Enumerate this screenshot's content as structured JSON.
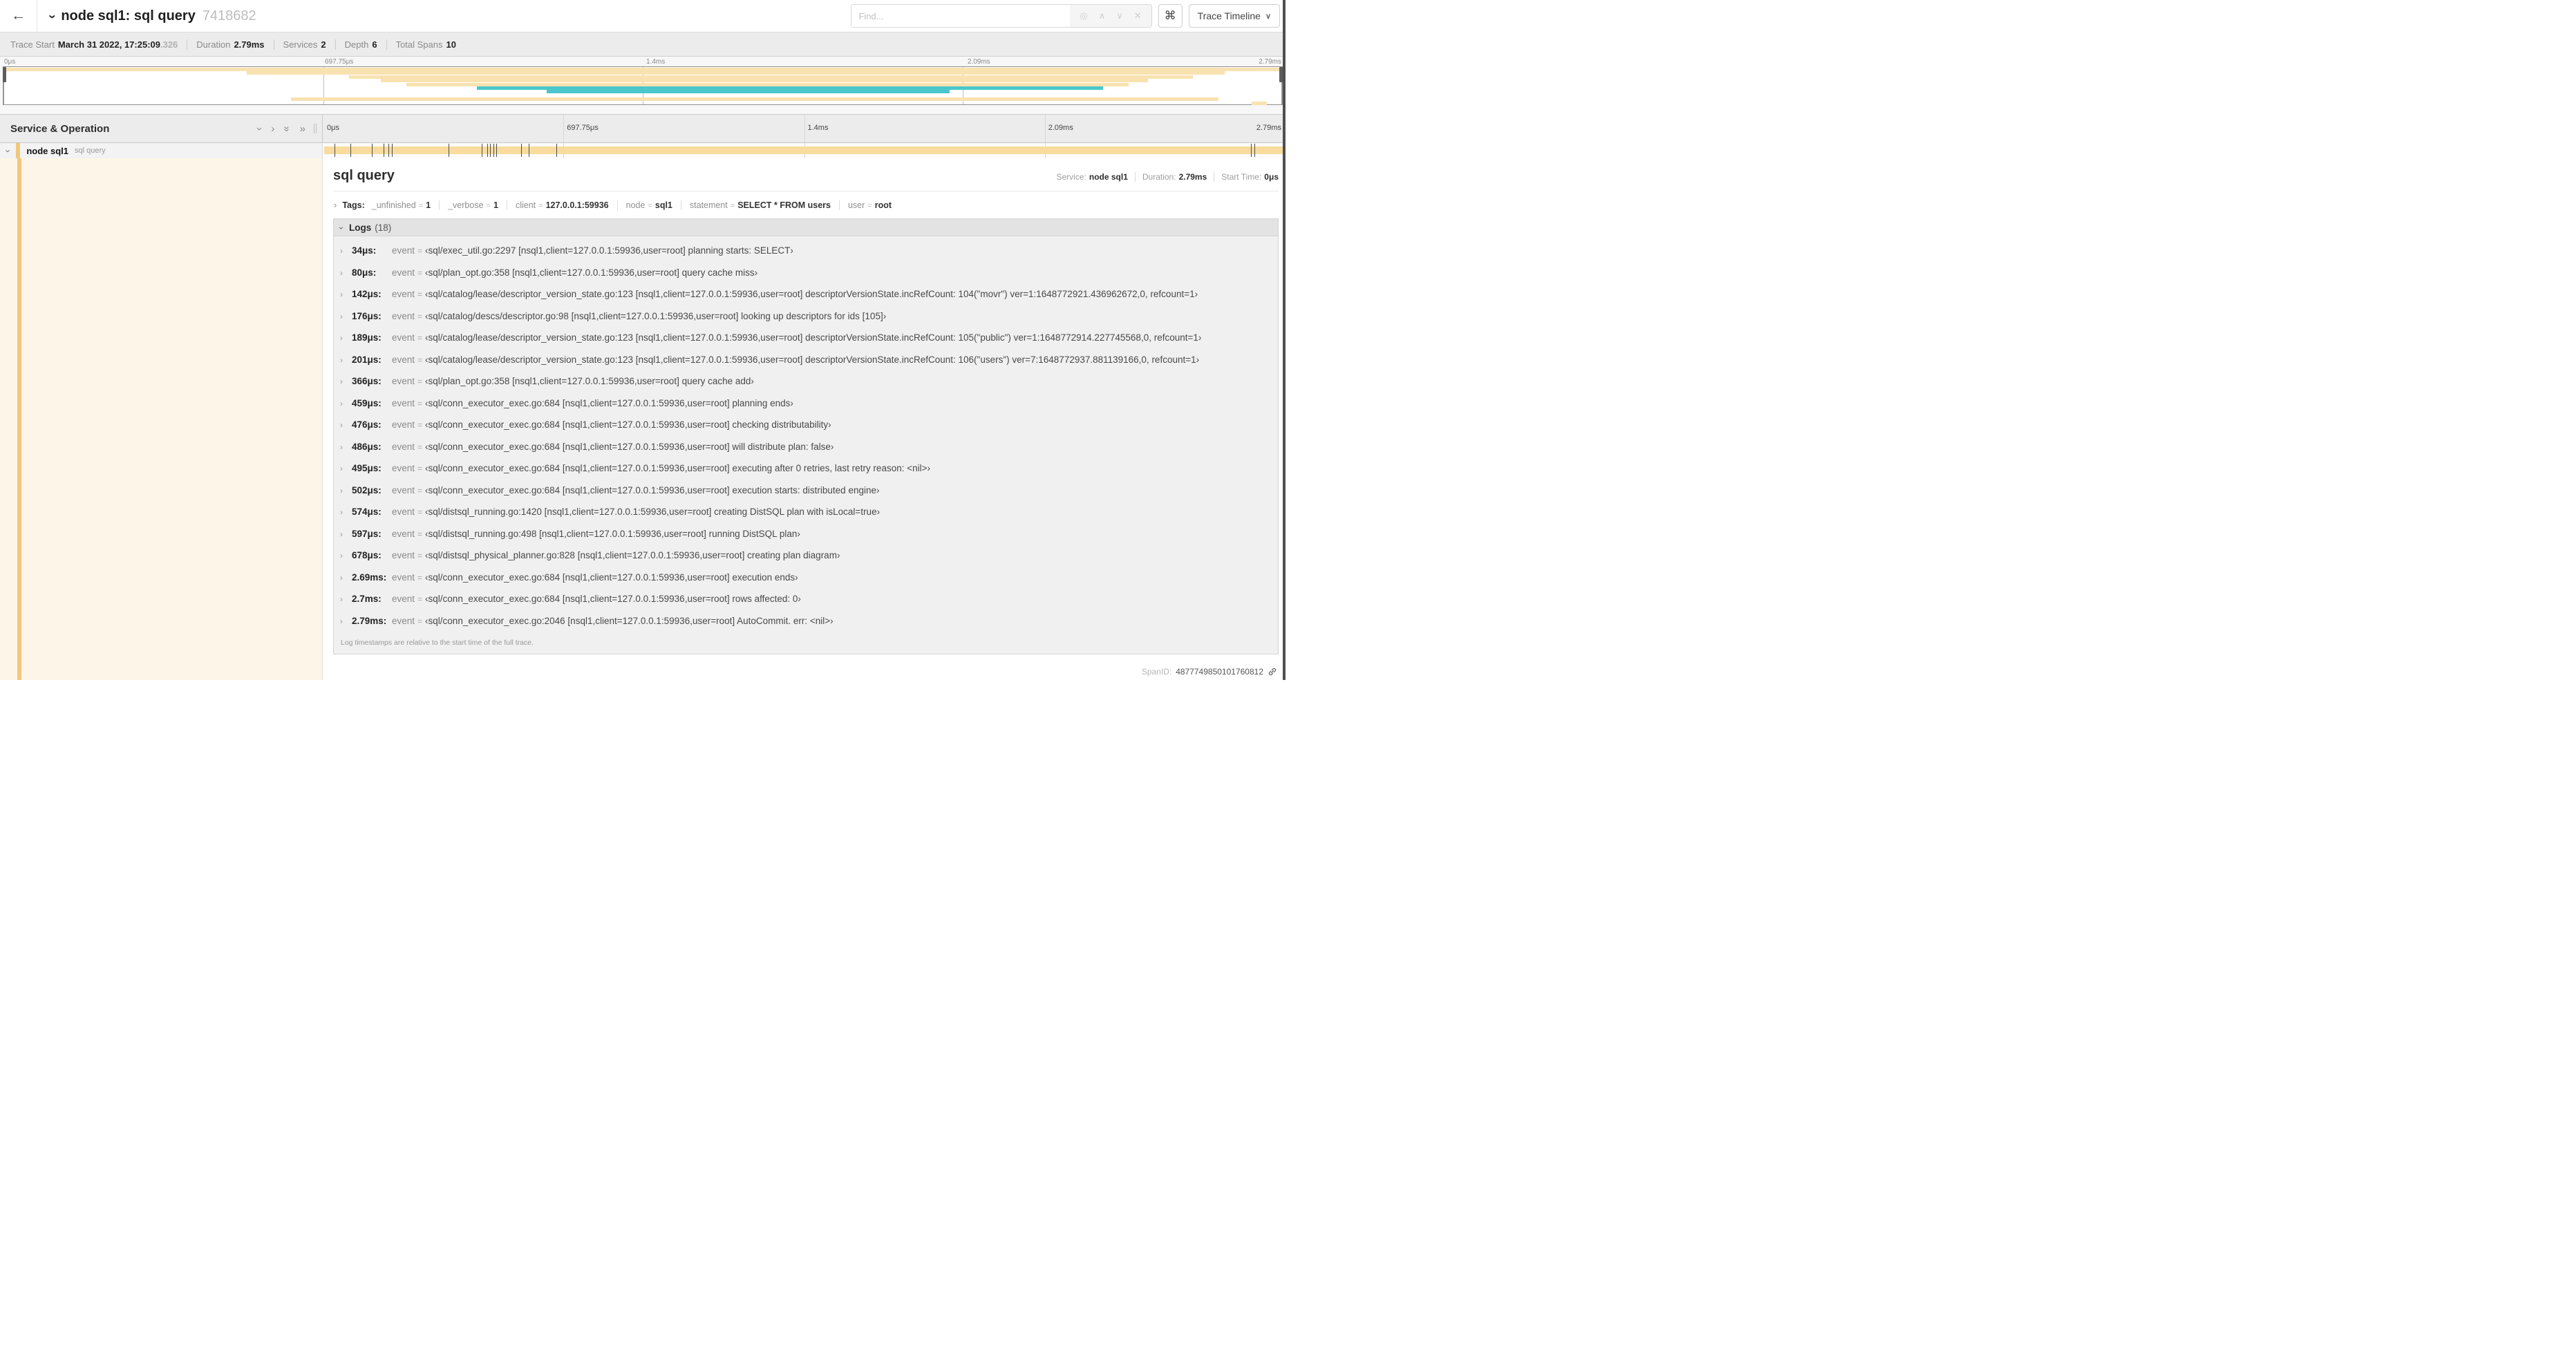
{
  "header": {
    "back_arrow": "←",
    "title": "node sql1: sql query",
    "trace_id": "7418682",
    "find_placeholder": "Find...",
    "find_icons": {
      "locate": "◎",
      "prev": "∧",
      "next": "∨",
      "clear": "✕"
    },
    "shortcut_key": "⌘",
    "view_selector": "Trace Timeline"
  },
  "meta": {
    "items": [
      {
        "label": "Trace Start",
        "value": "March 31 2022, 17:25:09",
        "suffix": ".326"
      },
      {
        "label": "Duration",
        "value": "2.79ms",
        "suffix": ""
      },
      {
        "label": "Services",
        "value": "2",
        "suffix": ""
      },
      {
        "label": "Depth",
        "value": "6",
        "suffix": ""
      },
      {
        "label": "Total Spans",
        "value": "10",
        "suffix": ""
      }
    ]
  },
  "minimap": {
    "labels": [
      {
        "text": "0μs",
        "pct": 0
      },
      {
        "text": "697.75μs",
        "pct": 25
      },
      {
        "text": "1.4ms",
        "pct": 50
      },
      {
        "text": "2.09ms",
        "pct": 75
      },
      {
        "text": "2.79ms",
        "pct": 100
      }
    ],
    "grid_pcts": [
      25,
      50,
      75
    ],
    "colors": {
      "yellow": "#f8e2b0",
      "teal": "#4bc6cc"
    },
    "bars": [
      {
        "row": 0,
        "start": 0,
        "end": 100,
        "color": "yellow"
      },
      {
        "row": 1,
        "start": 19,
        "end": 95.5,
        "color": "yellow"
      },
      {
        "row": 2,
        "start": 27,
        "end": 93,
        "color": "yellow"
      },
      {
        "row": 3,
        "start": 29.5,
        "end": 89.5,
        "color": "yellow"
      },
      {
        "row": 4,
        "start": 31.5,
        "end": 88,
        "color": "yellow"
      },
      {
        "row": 5,
        "start": 37,
        "end": 86,
        "color": "teal"
      },
      {
        "row": 6,
        "start": 42.5,
        "end": 74,
        "color": "teal"
      },
      {
        "row": 8,
        "start": 22.5,
        "end": 95,
        "color": "yellow"
      },
      {
        "row": 9,
        "start": 97.6,
        "end": 98.8,
        "color": "yellow"
      }
    ]
  },
  "timeline": {
    "col_header": "Service & Operation",
    "ticks": [
      {
        "text": "0μs",
        "pct": 0
      },
      {
        "text": "697.75μs",
        "pct": 25
      },
      {
        "text": "1.4ms",
        "pct": 50
      },
      {
        "text": "2.09ms",
        "pct": 75
      },
      {
        "text": "2.79ms",
        "pct": 100
      }
    ],
    "grid_pcts": [
      25,
      50,
      75
    ],
    "row": {
      "service": "node sql1",
      "operation": "sql query",
      "bar_color": "#f7dc9e",
      "accent_color": "#f1c77e",
      "log_tick_pcts": [
        1.2,
        2.9,
        5.1,
        6.3,
        6.8,
        7.2,
        13.1,
        16.5,
        17.1,
        17.4,
        17.7,
        18.0,
        20.6,
        21.4,
        24.3,
        96.4,
        96.8,
        99.8
      ]
    }
  },
  "detail": {
    "title": "sql query",
    "meta": [
      {
        "label": "Service:",
        "value": "node sql1"
      },
      {
        "label": "Duration:",
        "value": "2.79ms"
      },
      {
        "label": "Start Time:",
        "value": "0μs"
      }
    ],
    "tags": {
      "label": "Tags:",
      "pairs": [
        {
          "key": "_unfinished",
          "value": "1"
        },
        {
          "key": "_verbose",
          "value": "1"
        },
        {
          "key": "client",
          "value": "127.0.0.1:59936"
        },
        {
          "key": "node",
          "value": "sql1"
        },
        {
          "key": "statement",
          "value": "SELECT * FROM users"
        },
        {
          "key": "user",
          "value": "root"
        }
      ]
    },
    "logs": {
      "title": "Logs",
      "count": "(18)",
      "entries": [
        {
          "time": "34μs:",
          "field": "event",
          "value": "‹sql/exec_util.go:2297 [nsql1,client=127.0.0.1:59936,user=root] planning starts: SELECT›"
        },
        {
          "time": "80μs:",
          "field": "event",
          "value": "‹sql/plan_opt.go:358 [nsql1,client=127.0.0.1:59936,user=root] query cache miss›"
        },
        {
          "time": "142μs:",
          "field": "event",
          "value": "‹sql/catalog/lease/descriptor_version_state.go:123 [nsql1,client=127.0.0.1:59936,user=root] descriptorVersionState.incRefCount: 104(\"movr\") ver=1:1648772921.436962672,0, refcount=1›"
        },
        {
          "time": "176μs:",
          "field": "event",
          "value": "‹sql/catalog/descs/descriptor.go:98 [nsql1,client=127.0.0.1:59936,user=root] looking up descriptors for ids [105]›"
        },
        {
          "time": "189μs:",
          "field": "event",
          "value": "‹sql/catalog/lease/descriptor_version_state.go:123 [nsql1,client=127.0.0.1:59936,user=root] descriptorVersionState.incRefCount: 105(\"public\") ver=1:1648772914.227745568,0, refcount=1›"
        },
        {
          "time": "201μs:",
          "field": "event",
          "value": "‹sql/catalog/lease/descriptor_version_state.go:123 [nsql1,client=127.0.0.1:59936,user=root] descriptorVersionState.incRefCount: 106(\"users\") ver=7:1648772937.881139166,0, refcount=1›"
        },
        {
          "time": "366μs:",
          "field": "event",
          "value": "‹sql/plan_opt.go:358 [nsql1,client=127.0.0.1:59936,user=root] query cache add›"
        },
        {
          "time": "459μs:",
          "field": "event",
          "value": "‹sql/conn_executor_exec.go:684 [nsql1,client=127.0.0.1:59936,user=root] planning ends›"
        },
        {
          "time": "476μs:",
          "field": "event",
          "value": "‹sql/conn_executor_exec.go:684 [nsql1,client=127.0.0.1:59936,user=root] checking distributability›"
        },
        {
          "time": "486μs:",
          "field": "event",
          "value": "‹sql/conn_executor_exec.go:684 [nsql1,client=127.0.0.1:59936,user=root] will distribute plan: false›"
        },
        {
          "time": "495μs:",
          "field": "event",
          "value": "‹sql/conn_executor_exec.go:684 [nsql1,client=127.0.0.1:59936,user=root] executing after 0 retries, last retry reason: <nil>›"
        },
        {
          "time": "502μs:",
          "field": "event",
          "value": "‹sql/conn_executor_exec.go:684 [nsql1,client=127.0.0.1:59936,user=root] execution starts: distributed engine›"
        },
        {
          "time": "574μs:",
          "field": "event",
          "value": "‹sql/distsql_running.go:1420 [nsql1,client=127.0.0.1:59936,user=root] creating DistSQL plan with isLocal=true›"
        },
        {
          "time": "597μs:",
          "field": "event",
          "value": "‹sql/distsql_running.go:498 [nsql1,client=127.0.0.1:59936,user=root] running DistSQL plan›"
        },
        {
          "time": "678μs:",
          "field": "event",
          "value": "‹sql/distsql_physical_planner.go:828 [nsql1,client=127.0.0.1:59936,user=root] creating plan diagram›"
        },
        {
          "time": "2.69ms:",
          "field": "event",
          "value": "‹sql/conn_executor_exec.go:684 [nsql1,client=127.0.0.1:59936,user=root] execution ends›"
        },
        {
          "time": "2.7ms:",
          "field": "event",
          "value": "‹sql/conn_executor_exec.go:684 [nsql1,client=127.0.0.1:59936,user=root] rows affected: 0›"
        },
        {
          "time": "2.79ms:",
          "field": "event",
          "value": "‹sql/conn_executor_exec.go:2046 [nsql1,client=127.0.0.1:59936,user=root] AutoCommit. err: <nil>›"
        }
      ],
      "footnote": "Log timestamps are relative to the start time of the full trace."
    },
    "span_id_label": "SpanID:",
    "span_id": "4877749850101760812"
  }
}
